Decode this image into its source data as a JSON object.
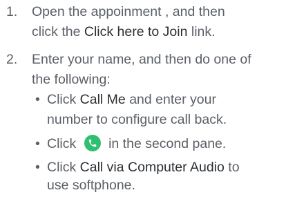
{
  "steps": [
    {
      "number": "1.",
      "line1": "Open the appoinment , and then",
      "line2_prefix": "click the ",
      "line2_bold": "Click here to Join",
      "line2_suffix": " link."
    },
    {
      "number": "2.",
      "line1": "Enter your name, and then do one of",
      "line2": "the following:",
      "options": [
        {
          "bullet": "•",
          "prefix": "Click ",
          "bold": "Call Me",
          "suffix": " and enter your",
          "line2": "number to configure call back."
        },
        {
          "bullet": "•",
          "prefix": "Click ",
          "icon": "phone-call-icon",
          "suffix": " in the second pane."
        },
        {
          "bullet": "•",
          "prefix": "Click ",
          "bold": "Call via Computer Audio",
          "suffix": " to",
          "line2": "use softphone."
        }
      ]
    }
  ],
  "colors": {
    "text": "#5a5f66",
    "emphasis": "#2b2f33",
    "call_icon": "#2fbf71"
  }
}
